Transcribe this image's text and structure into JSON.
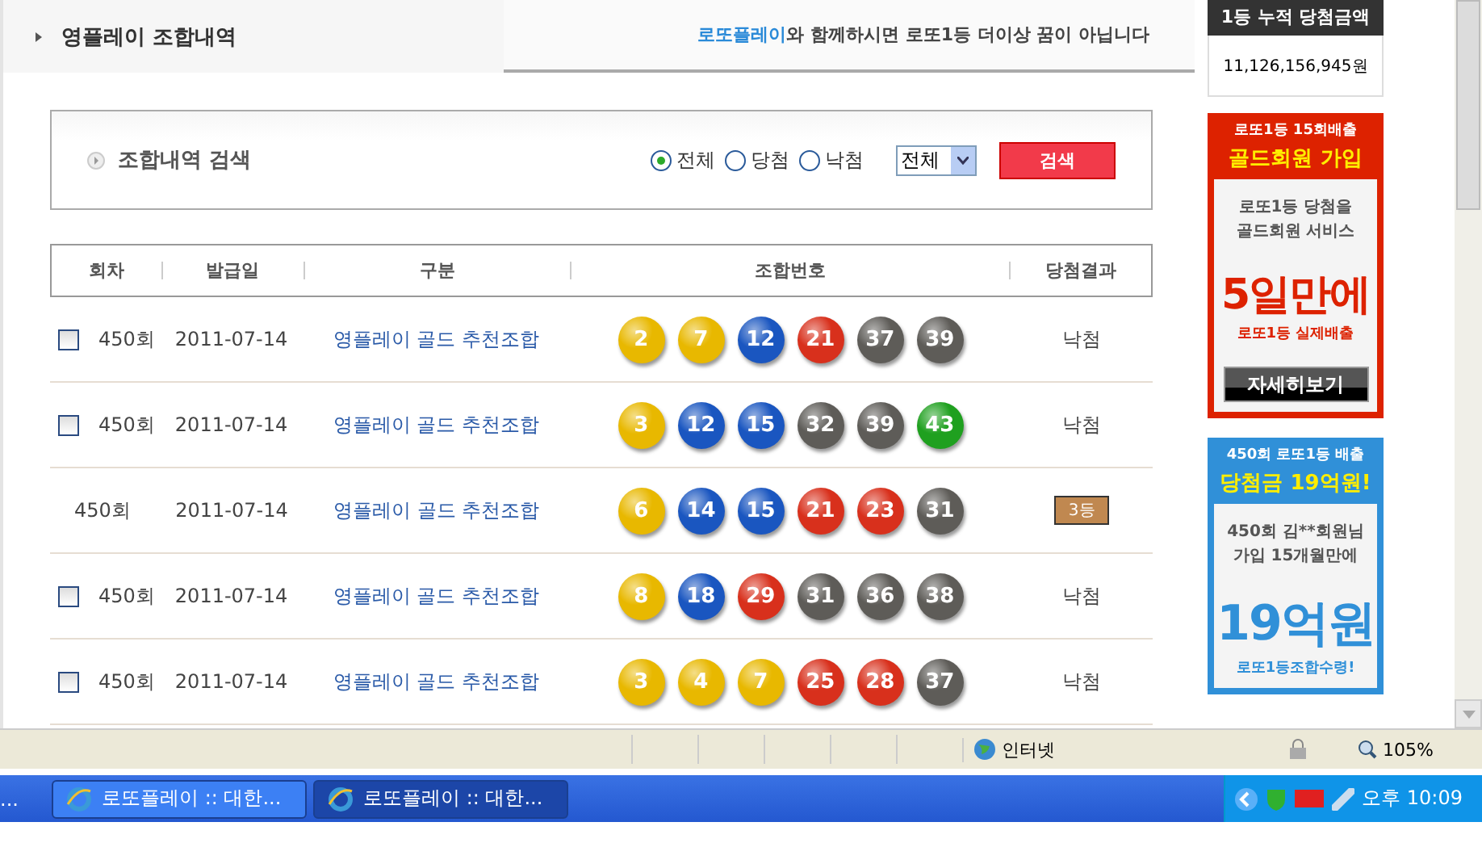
{
  "header": {
    "title": "영플레이 조합내역",
    "slogan_brand": "로또플레이",
    "slogan_rest": "와 함께하시면 로또1등 더이상 꿈이 아닙니다"
  },
  "search": {
    "title": "조합내역 검색",
    "options": [
      {
        "label": "전체",
        "selected": true
      },
      {
        "label": "당첨",
        "selected": false
      },
      {
        "label": "낙첨",
        "selected": false
      }
    ],
    "select_value": "전체",
    "button": "검색"
  },
  "table": {
    "columns": [
      "회차",
      "발급일",
      "구분",
      "조합번호",
      "당첨결과"
    ],
    "rows": [
      {
        "kind": "checkbox",
        "checked": false,
        "round": "450회",
        "date": "2011-07-14",
        "type": "영플레이 골드 추천조합",
        "balls": [
          {
            "number": "2",
            "color": "#e8b800"
          },
          {
            "number": "7",
            "color": "#e8b800"
          },
          {
            "number": "12",
            "color": "#1a56c0"
          },
          {
            "number": "21",
            "color": "#d8301c"
          },
          {
            "number": "37",
            "color": "#5e5c58"
          },
          {
            "number": "39",
            "color": "#5e5c58"
          }
        ],
        "result": {
          "kind": "text",
          "label": "낙첨"
        }
      },
      {
        "kind": "checkbox",
        "checked": false,
        "round": "450회",
        "date": "2011-07-14",
        "type": "영플레이 골드 추천조합",
        "balls": [
          {
            "number": "3",
            "color": "#e8b800"
          },
          {
            "number": "12",
            "color": "#1a56c0"
          },
          {
            "number": "15",
            "color": "#1a56c0"
          },
          {
            "number": "32",
            "color": "#5e5c58"
          },
          {
            "number": "39",
            "color": "#5e5c58"
          },
          {
            "number": "43",
            "color": "#1fa01f"
          }
        ],
        "result": {
          "kind": "text",
          "label": "낙첨"
        }
      },
      {
        "kind": "plain",
        "round": "450회",
        "date": "2011-07-14",
        "type": "영플레이 골드 추천조합",
        "balls": [
          {
            "number": "6",
            "color": "#e8b800"
          },
          {
            "number": "14",
            "color": "#1a56c0"
          },
          {
            "number": "15",
            "color": "#1a56c0"
          },
          {
            "number": "21",
            "color": "#d8301c"
          },
          {
            "number": "23",
            "color": "#d8301c"
          },
          {
            "number": "31",
            "color": "#5e5c58"
          }
        ],
        "result": {
          "kind": "badge",
          "label": "3등"
        }
      },
      {
        "kind": "checkbox",
        "checked": false,
        "round": "450회",
        "date": "2011-07-14",
        "type": "영플레이 골드 추천조합",
        "balls": [
          {
            "number": "8",
            "color": "#e8b800"
          },
          {
            "number": "18",
            "color": "#1a56c0"
          },
          {
            "number": "29",
            "color": "#d8301c"
          },
          {
            "number": "31",
            "color": "#5e5c58"
          },
          {
            "number": "36",
            "color": "#5e5c58"
          },
          {
            "number": "38",
            "color": "#5e5c58"
          }
        ],
        "result": {
          "kind": "text",
          "label": "낙첨"
        }
      },
      {
        "kind": "checkbox",
        "checked": false,
        "round": "450회",
        "date": "2011-07-14",
        "type": "영플레이 골드 추천조합",
        "balls": [
          {
            "number": "3",
            "color": "#e8b800"
          },
          {
            "number": "4",
            "color": "#e8b800"
          },
          {
            "number": "7",
            "color": "#e8b800"
          },
          {
            "number": "25",
            "color": "#d8301c"
          },
          {
            "number": "28",
            "color": "#d8301c"
          },
          {
            "number": "37",
            "color": "#5e5c58"
          }
        ],
        "result": {
          "kind": "text",
          "label": "낙첨"
        }
      }
    ]
  },
  "sidebar": {
    "jackpot_title": "1등 누적 당첨금액",
    "jackpot_amount": "11,126,156,945원",
    "ads": [
      {
        "kind": "red",
        "top": "로또1등 15회배출",
        "headline": "골드회원 가입",
        "body": [
          "로또1등 당첨을",
          "골드회원 서비스"
        ],
        "big": "5일만에",
        "sub": "로또1등 실제배출",
        "button": "자세히보기"
      },
      {
        "kind": "blue",
        "top": "450회 로또1등 배출",
        "headline": "당첨금 19억원!",
        "body": [
          "450회 김**회원님",
          "가입 15개월만에"
        ],
        "big": "19억원",
        "sub": "로또1등조합수령!"
      }
    ]
  },
  "status_bar": {
    "zone": "인터넷",
    "zoom": "105%"
  },
  "taskbar": {
    "overflow": "...",
    "tasks": [
      {
        "label": "로또플레이 :: 대한...",
        "selected": false
      },
      {
        "label": "로또플레이 :: 대한...",
        "selected": true
      }
    ],
    "clock": "오후 10:09"
  }
}
